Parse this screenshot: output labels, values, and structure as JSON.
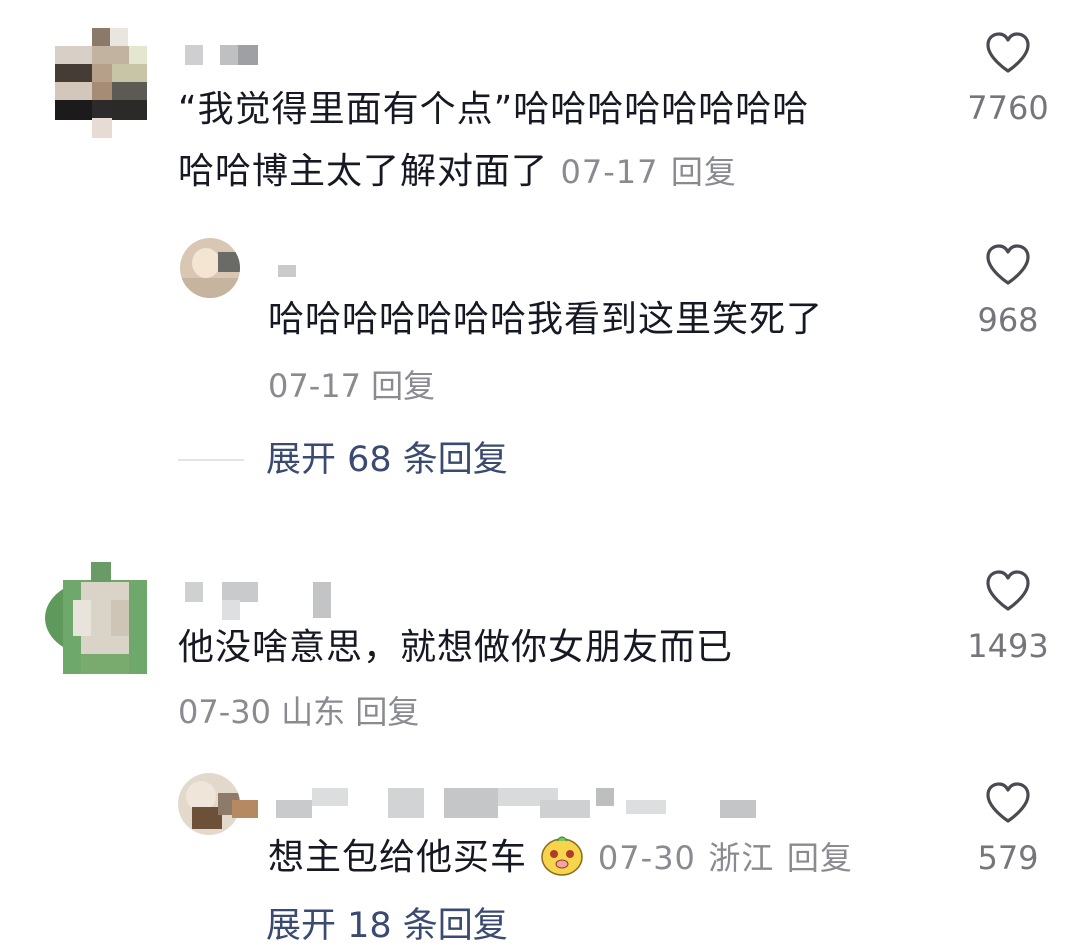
{
  "comments": [
    {
      "text_line1": "“我觉得里面有个点”哈哈哈哈哈哈哈哈",
      "text_line2": "哈哈博主太了解对面了",
      "date": "07-17",
      "reply_label": "回复",
      "likes": "7760",
      "replies": [
        {
          "text": "哈哈哈哈哈哈哈我看到这里笑死了",
          "date": "07-17",
          "reply_label": "回复",
          "likes": "968"
        }
      ],
      "expand_label": "展开 68 条回复"
    },
    {
      "text": "他没啥意思，就想做你女朋友而已",
      "date": "07-30",
      "location": "山东",
      "reply_label": "回复",
      "likes": "1493",
      "replies": [
        {
          "text": "想主包给他买车",
          "date": "07-30",
          "location": "浙江",
          "reply_label": "回复",
          "likes": "579"
        }
      ],
      "expand_label": "展开 18 条回复"
    }
  ],
  "icons": {
    "like": "heart-outline-icon",
    "emoji": "smiling-dog-emoji"
  },
  "colors": {
    "text": "#161823",
    "meta": "#8a8b91",
    "expand": "#3b4a70",
    "divider": "#e3e4e6"
  }
}
